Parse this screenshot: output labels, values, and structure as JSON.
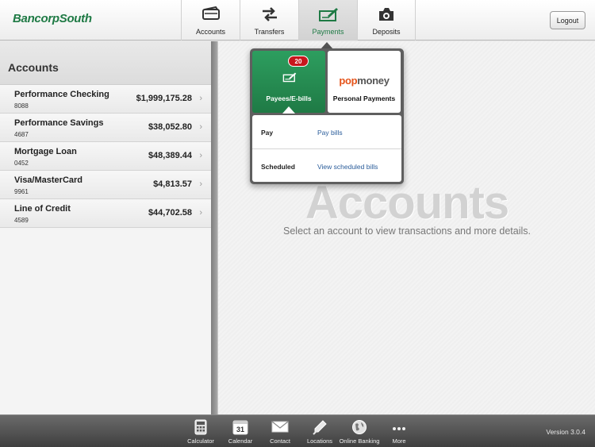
{
  "header": {
    "logo": "BancorpSouth",
    "tabs": [
      {
        "label": "Accounts",
        "icon": "wallet-icon"
      },
      {
        "label": "Transfers",
        "icon": "transfer-arrows-icon"
      },
      {
        "label": "Payments",
        "icon": "check-pen-icon"
      },
      {
        "label": "Deposits",
        "icon": "camera-icon"
      }
    ],
    "active_tab": "Payments",
    "logout_label": "Logout"
  },
  "sidebar": {
    "title": "Accounts",
    "accounts": [
      {
        "name": "Performance Checking",
        "number": "8088",
        "balance": "$1,999,175.28"
      },
      {
        "name": "Performance Savings",
        "number": "4687",
        "balance": "$38,052.80"
      },
      {
        "name": "Mortgage Loan",
        "number": "0452",
        "balance": "$48,389.44"
      },
      {
        "name": "Visa/MasterCard",
        "number": "9961",
        "balance": "$4,813.57"
      },
      {
        "name": "Line of Credit",
        "number": "4589",
        "balance": "$44,702.58"
      }
    ]
  },
  "main": {
    "title": "Accounts",
    "subtitle": "Select an account to view transactions and more details."
  },
  "popover": {
    "tiles": [
      {
        "label": "Payees/E-bills",
        "badge": "20",
        "icon": "check-pen-icon"
      },
      {
        "label": "Personal Payments",
        "logo_pop": "pop",
        "logo_money": "money"
      }
    ],
    "rows": [
      {
        "label": "Pay",
        "link": "Pay bills"
      },
      {
        "label": "Scheduled",
        "link": "View scheduled bills"
      }
    ]
  },
  "footer": {
    "tools": [
      {
        "label": "Calculator",
        "icon": "calculator-icon"
      },
      {
        "label": "Calendar",
        "icon": "calendar-icon",
        "date": "31"
      },
      {
        "label": "Contact",
        "icon": "envelope-icon"
      },
      {
        "label": "Locations",
        "icon": "location-pin-icon"
      },
      {
        "label": "Online Banking",
        "icon": "globe-icon"
      },
      {
        "label": "More",
        "icon": "more-dots-icon"
      }
    ],
    "version": "Version 3.0.4"
  },
  "colors": {
    "brand_green": "#1f7a45",
    "badge_red": "#c8161d",
    "link_blue": "#2a5c9a",
    "popmoney_orange": "#e5531a"
  }
}
